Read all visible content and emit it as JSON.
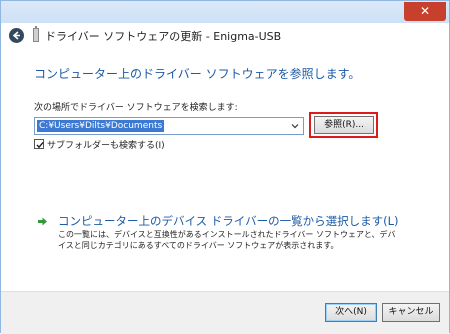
{
  "titlebar": {
    "close_label": "✕"
  },
  "header": {
    "title": "ドライバー ソフトウェアの更新 - Enigma-USB"
  },
  "main": {
    "heading": "コンピューター上のドライバー ソフトウェアを参照します。",
    "search_label": "次の場所でドライバー ソフトウェアを検索します:",
    "path_value": "C:¥Users¥Dilts¥Documents",
    "browse_label": "参照(R)...",
    "include_subfolders_label": "サブフォルダーも検索する(I)",
    "include_subfolders_checked": true,
    "pick_link_label": "コンピューター上のデバイス ドライバーの一覧から選択します(L)",
    "pick_description": "この一覧には、デバイスと互換性があるインストールされたドライバー ソフトウェアと、デバイスと同じカテゴリにあるすべてのドライバー ソフトウェアが表示されます。"
  },
  "footer": {
    "next_label": "次へ(N)",
    "cancel_label": "キャンセル"
  },
  "colors": {
    "accent": "#1b5aa6",
    "selection": "#3c79d4",
    "highlight_border": "#e0191b",
    "close_button": "#c7402d",
    "arrow_green": "#2e9b3a"
  }
}
